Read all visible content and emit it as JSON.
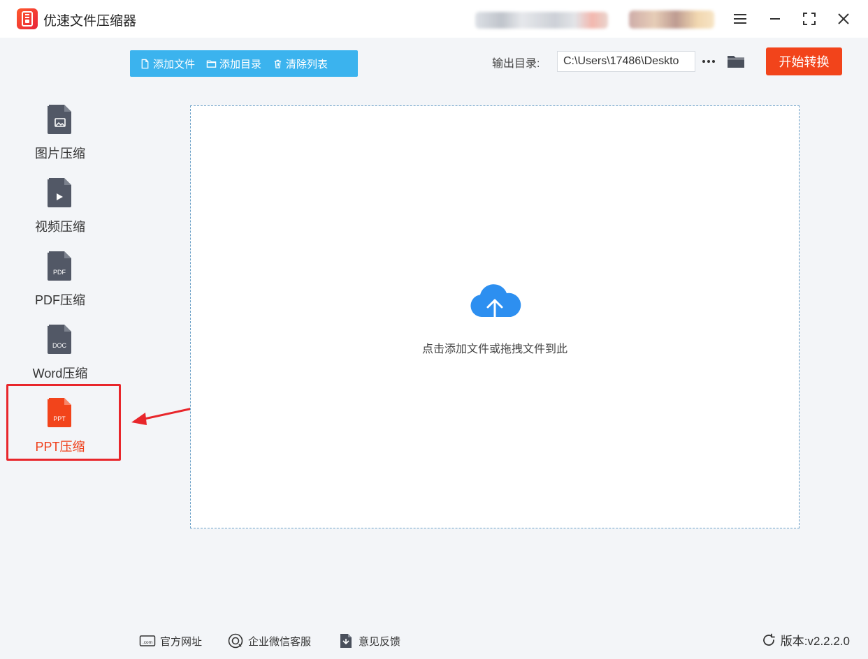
{
  "window": {
    "title": "优速文件压缩器"
  },
  "toolbar": {
    "add_file": "添加文件",
    "add_folder": "添加目录",
    "clear_list": "清除列表",
    "output_label": "输出目录:",
    "output_path": "C:\\Users\\17486\\Deskto",
    "start_button": "开始转换"
  },
  "sidebar": {
    "items": [
      {
        "label": "图片压缩",
        "badge": ""
      },
      {
        "label": "视频压缩",
        "badge": ""
      },
      {
        "label": "PDF压缩",
        "badge": "PDF"
      },
      {
        "label": "Word压缩",
        "badge": "DOC"
      },
      {
        "label": "PPT压缩",
        "badge": "PPT"
      }
    ],
    "active_index": 4
  },
  "dropzone": {
    "hint": "点击添加文件或拖拽文件到此"
  },
  "footer": {
    "website": "官方网址",
    "website_icon_text": ".com",
    "wechat": "企业微信客服",
    "feedback": "意见反馈",
    "version": "版本:v2.2.2.0"
  },
  "colors": {
    "accent_blue": "#3bb3ee",
    "start_red": "#f2441b",
    "active_red": "#ef3f1a",
    "highlight_box": "#e8262b",
    "icon_gray": "#525866",
    "cloud_blue": "#2d8ff0"
  }
}
